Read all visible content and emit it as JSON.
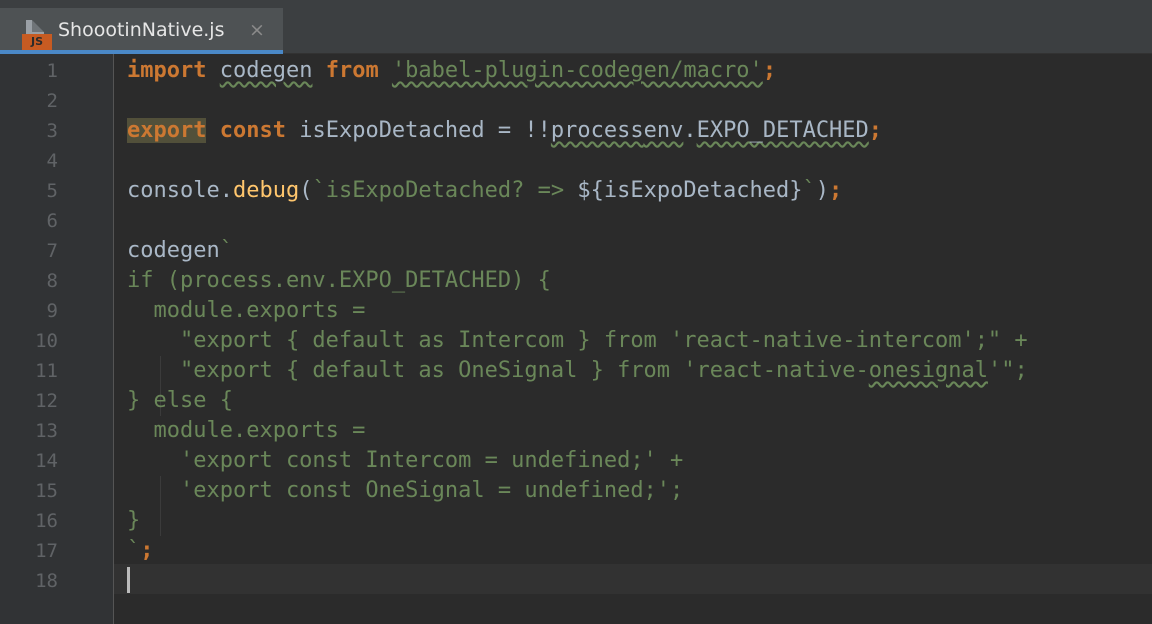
{
  "tab": {
    "title": "ShoootinNative.js",
    "icon_label": "JS",
    "close_glyph": "×"
  },
  "line_numbers": [
    "1",
    "2",
    "3",
    "4",
    "5",
    "6",
    "7",
    "8",
    "9",
    "10",
    "11",
    "12",
    "13",
    "14",
    "15",
    "16",
    "17",
    "18"
  ],
  "code": {
    "l1": {
      "kw1": "import",
      "id": "codegen",
      "kw2": "from",
      "str": "'babel-plugin-codegen/macro'",
      "semi": ";"
    },
    "l3": {
      "kw1": "export",
      "kw2": "const",
      "rest": "isExpoDetached = !!",
      "p": "process",
      ".": ".",
      "env": "env",
      "dot2": ".",
      "var": "EXPO_DETACHED",
      "semi": ";"
    },
    "l5": {
      "obj": "console.",
      "fn": "debug",
      "open": "(",
      "tpl": "`isExpoDetached? => ",
      "interp": "${isExpoDetached}",
      "tick": "`",
      "close": ")",
      "semi": ";"
    },
    "l7": {
      "id": "codegen",
      "tick": "`"
    },
    "l8": "if (process.env.EXPO_DETACHED) {",
    "l9": "  module.exports =",
    "l10": "    \"export { default as Intercom } from 'react-native-intercom';\" +",
    "l11a": "    \"export { default as OneSignal } from 'react-native-",
    "l11b": "onesignal",
    "l11c": "'\";",
    "l12": "} else {",
    "l13": "  module.exports =",
    "l14": "    'export const Intercom = undefined;' +",
    "l15": "    'export const OneSignal = undefined;';",
    "l16": "}",
    "l17a": "`",
    "l17b": ";"
  }
}
